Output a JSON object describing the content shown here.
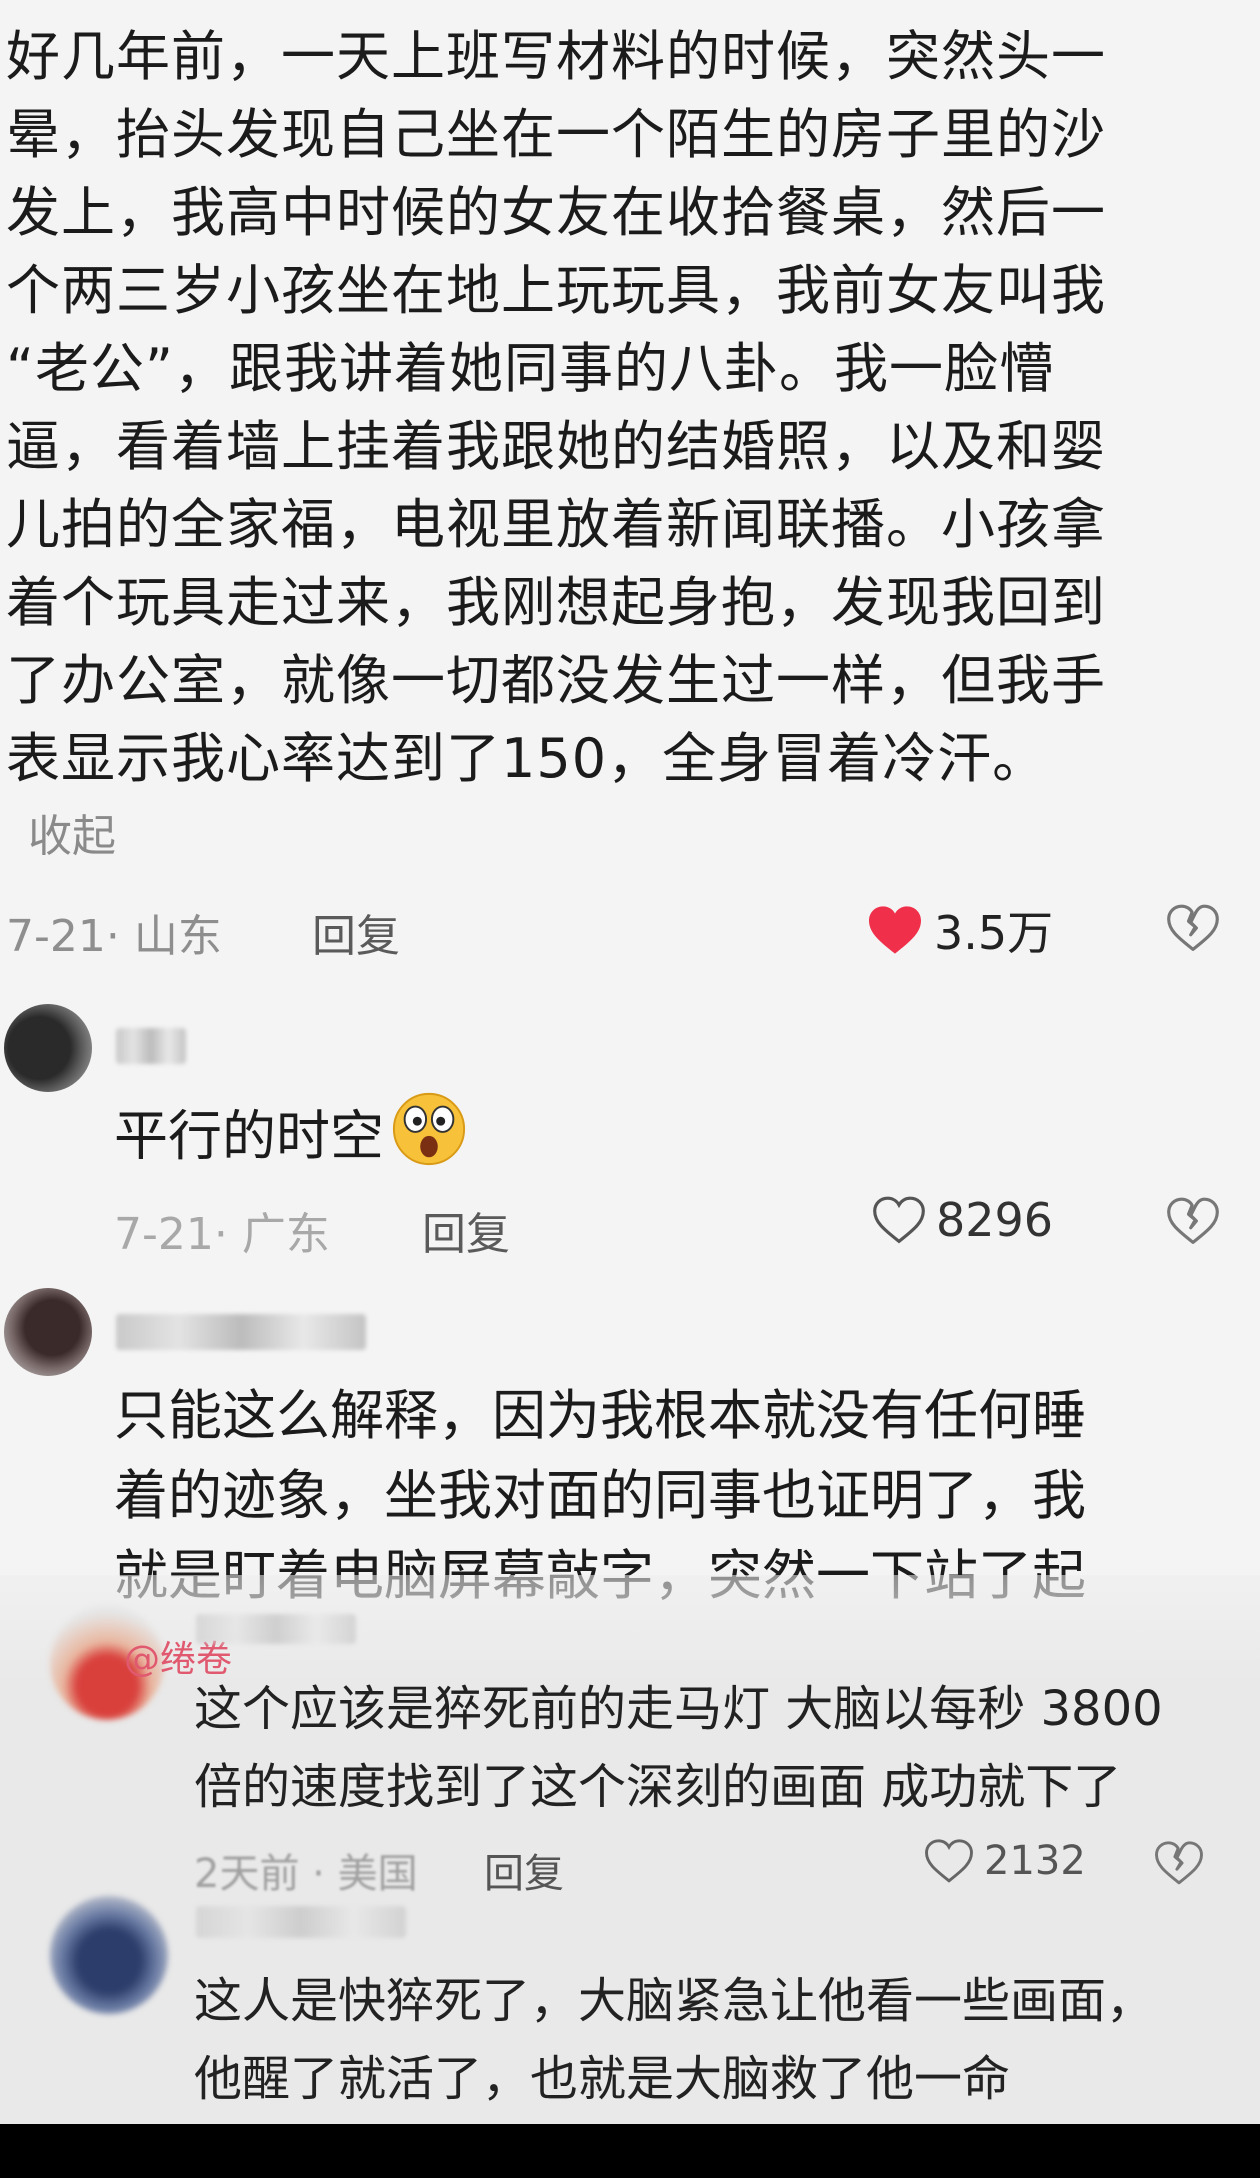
{
  "post": {
    "lines": [
      "好几年前，一天上班写材料的时候，突然头一",
      "晕，抬头发现自己坐在一个陌生的房子里的沙",
      "发上，我高中时候的女友在收拾餐桌，然后一",
      "个两三岁小孩坐在地上玩玩具，我前女友叫我",
      "“老公”，跟我讲着她同事的八卦。我一脸懵",
      "逼，看着墙上挂着我跟她的结婚照，以及和婴",
      "儿拍的全家福，电视里放着新闻联播。小孩拿",
      "着个玩具走过来，我刚想起身抱，发现我回到",
      "了办公室，就像一切都没发生过一样，但我手",
      "表显示我心率达到了150，全身冒着冷汗。"
    ],
    "collapse_label": "收起",
    "meta": "7-21· 山东",
    "reply_label": "回复",
    "likes": "3.5万"
  },
  "comments": [
    {
      "text": "平行的时空",
      "meta": "7-21· 广东",
      "reply_label": "回复",
      "likes": "8296"
    },
    {
      "lines": [
        "只能这么解释，因为我根本就没有任何睡",
        "着的迹象，坐我对面的同事也证明了，我",
        "就是盯着电脑屏幕敲字，突然一下站了起"
      ]
    }
  ],
  "sub_comments": [
    {
      "mention": "@绻卷",
      "lines": [
        "这个应该是猝死前的走马灯 大脑以每秒 3800",
        "倍的速度找到了这个深刻的画面 成功就下了"
      ],
      "meta": "2天前 · 美国",
      "reply_label": "回复",
      "likes": "2132"
    },
    {
      "lines": [
        "这人是快猝死了，大脑紧急让他看一些画面，",
        "他醒了就活了，也就是大脑救了他一命"
      ]
    }
  ],
  "colors": {
    "liked_heart": "#f0304a",
    "text": "#1b1b1b",
    "meta": "#8e8e8e",
    "mention": "#e0596f"
  }
}
